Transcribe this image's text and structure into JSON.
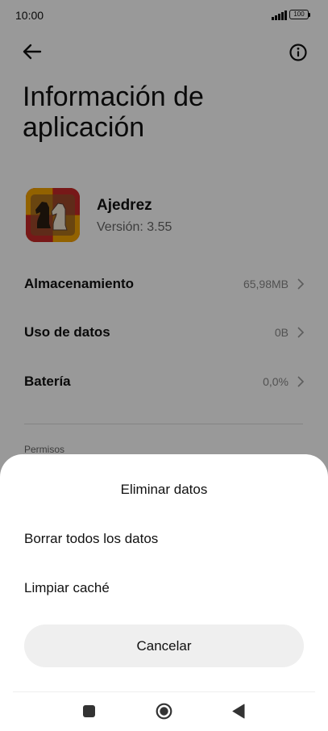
{
  "status_bar": {
    "time": "10:00",
    "battery": "100"
  },
  "header": {
    "title": "Información de aplicación"
  },
  "app": {
    "name": "Ajedrez",
    "version": "Versión: 3.55"
  },
  "rows": [
    {
      "label": "Almacenamiento",
      "value": "65,98MB"
    },
    {
      "label": "Uso de datos",
      "value": "0B"
    },
    {
      "label": "Batería",
      "value": "0,0%"
    }
  ],
  "section": {
    "label": "Permisos"
  },
  "sheet": {
    "title": "Eliminar datos",
    "options": [
      "Borrar todos los datos",
      "Limpiar caché"
    ],
    "cancel_label": "Cancelar"
  }
}
